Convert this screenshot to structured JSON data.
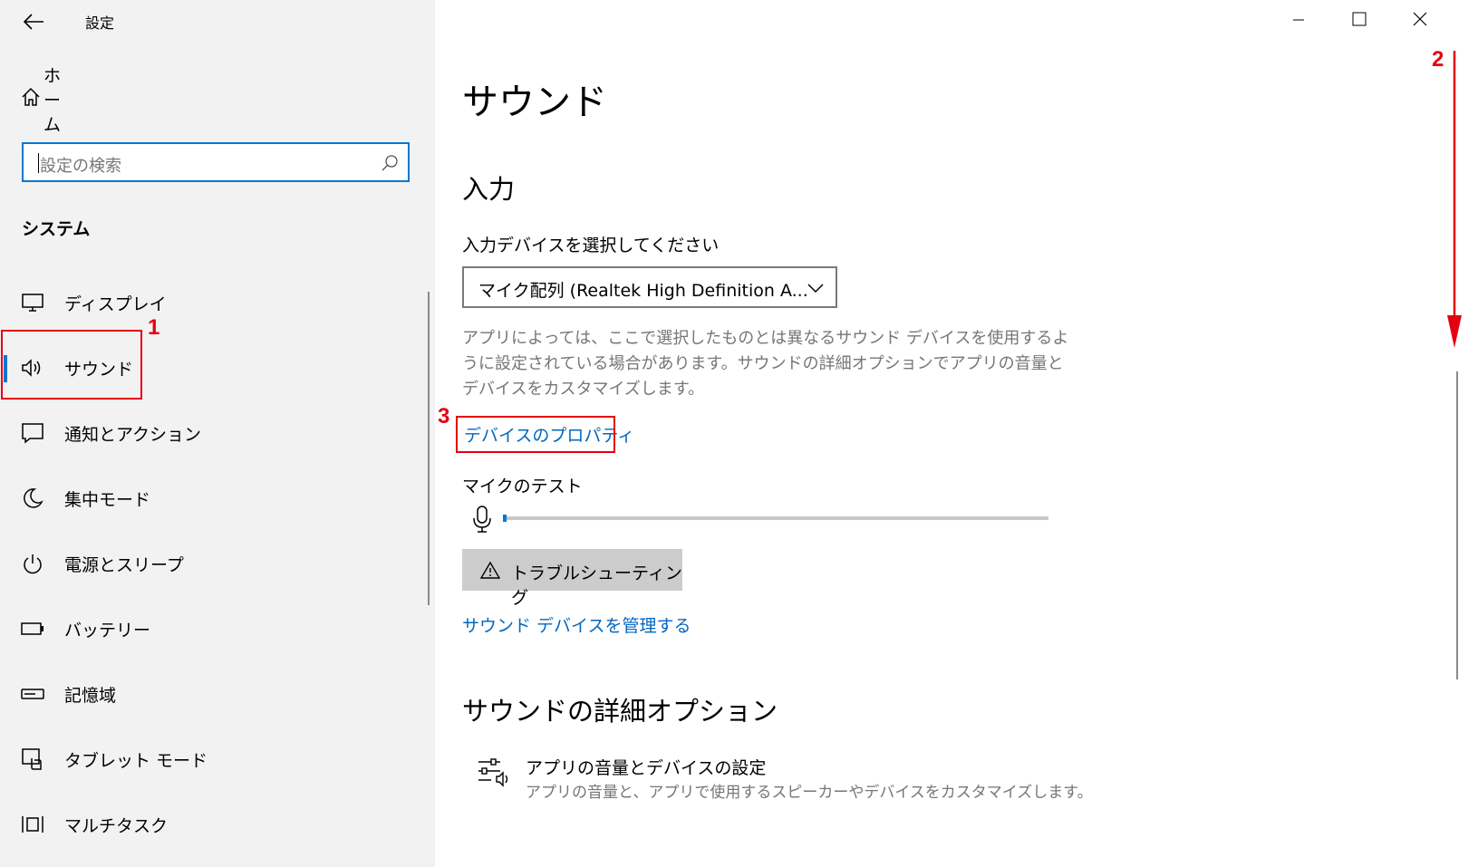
{
  "window": {
    "title": "設定",
    "controls": [
      "minimize-icon",
      "maximize-icon",
      "close-icon"
    ]
  },
  "sidebar": {
    "home_label": "ホーム",
    "search_placeholder": "設定の検索",
    "section_title": "システム",
    "items": [
      {
        "label": "ディスプレイ",
        "icon": "display-icon"
      },
      {
        "label": "サウンド",
        "icon": "speaker-icon",
        "active": true
      },
      {
        "label": "通知とアクション",
        "icon": "notification-icon"
      },
      {
        "label": "集中モード",
        "icon": "moon-icon"
      },
      {
        "label": "電源とスリープ",
        "icon": "power-icon"
      },
      {
        "label": "バッテリー",
        "icon": "battery-icon"
      },
      {
        "label": "記憶域",
        "icon": "storage-icon"
      },
      {
        "label": "タブレット モード",
        "icon": "tablet-icon"
      },
      {
        "label": "マルチタスク",
        "icon": "multitask-icon"
      }
    ]
  },
  "main": {
    "title": "サウンド",
    "input_heading": "入力",
    "select_label": "入力デバイスを選択してください",
    "selected_device": "マイク配列 (Realtek High Definition A...",
    "description": "アプリによっては、ここで選択したものとは異なるサウンド デバイスを使用するように設定されている場合があります。サウンドの詳細オプションでアプリの音量とデバイスをカスタマイズします。",
    "device_properties_link": "デバイスのプロパティ",
    "mic_test_label": "マイクのテスト",
    "mic_level": 0,
    "troubleshoot_label": "トラブルシューティング",
    "manage_devices_link": "サウンド デバイスを管理する",
    "advanced_heading": "サウンドの詳細オプション",
    "advanced_item_title": "アプリの音量とデバイスの設定",
    "advanced_item_desc": "アプリの音量と、アプリで使用するスピーカーやデバイスをカスタマイズします。"
  },
  "annotations": {
    "marker_1": "1",
    "marker_2": "2",
    "marker_3": "3",
    "color": "#e50012"
  },
  "colors": {
    "accent": "#0078d7",
    "link": "#0067c0",
    "sidebar_bg": "#f2f2f2"
  }
}
